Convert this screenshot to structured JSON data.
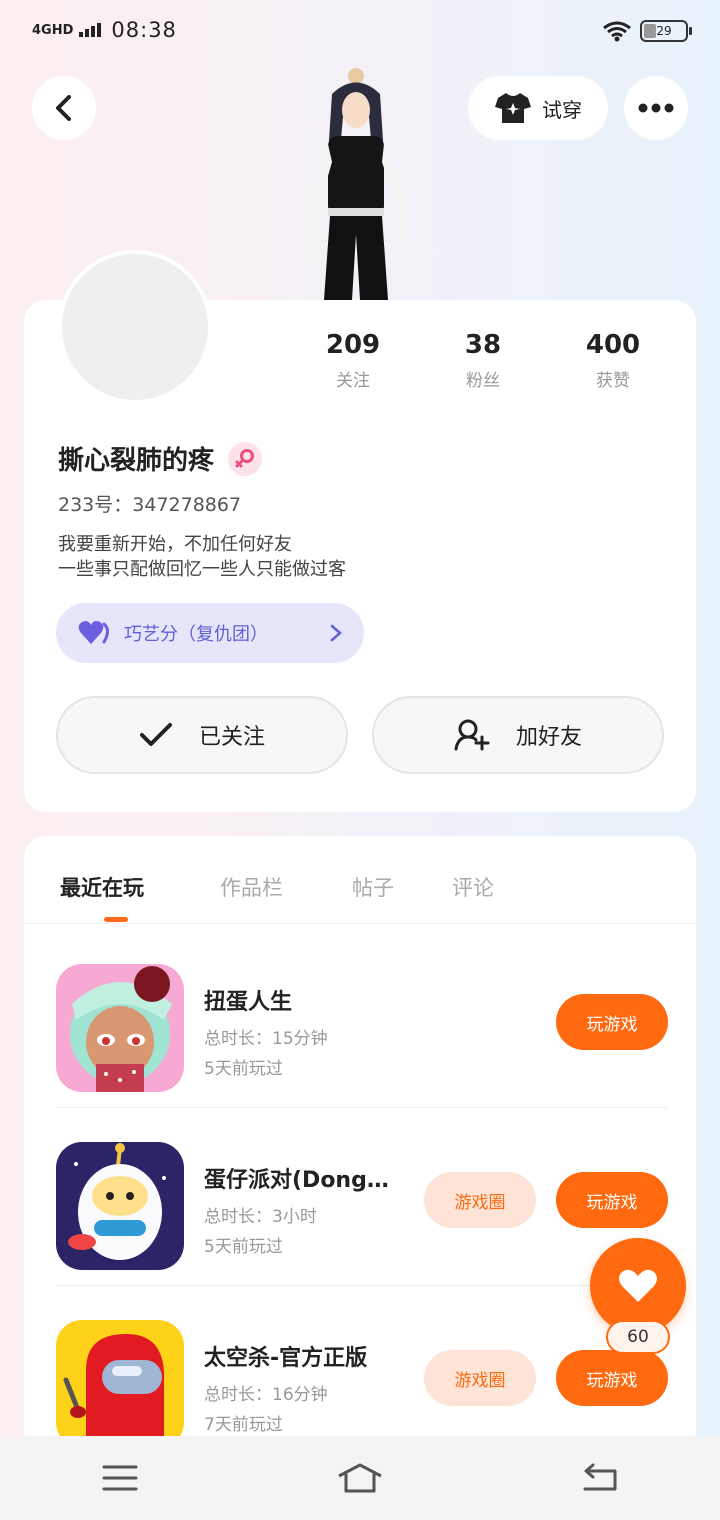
{
  "status_bar": {
    "network": "4GHD",
    "time": "08:38",
    "battery": "29"
  },
  "header": {
    "try_on_label": "试穿"
  },
  "profile": {
    "stats": [
      {
        "value": "209",
        "label": "关注"
      },
      {
        "value": "38",
        "label": "粉丝"
      },
      {
        "value": "400",
        "label": "获赞"
      }
    ],
    "username": "撕心裂肺的疼",
    "uid": "233号：347278867",
    "bio_lines": [
      "我要重新开始，不加任何好友",
      "一些事只配做回忆一些人只能做过客"
    ],
    "skill": "巧艺分（复仇团）",
    "followed_label": "已关注",
    "add_friend_label": "加好友"
  },
  "tabs": [
    "最近在玩",
    "作品栏",
    "帖子",
    "评论"
  ],
  "games": [
    {
      "name": "扭蛋人生",
      "duration": "总时长：15分钟",
      "last_played": "5天前玩过",
      "circle_label": null,
      "play_label": "玩游戏"
    },
    {
      "name": "蛋仔派对(Dong…",
      "duration": "总时长：3小时",
      "last_played": "5天前玩过",
      "circle_label": "游戏圈",
      "play_label": "玩游戏"
    },
    {
      "name": "太空杀-官方正版",
      "duration": "总时长：16分钟",
      "last_played": "7天前玩过",
      "circle_label": "游戏圈",
      "play_label": "玩游戏"
    }
  ],
  "like_count": "60",
  "colors": {
    "accent": "#ff6a10",
    "skill_bg": "#e6e6fb",
    "skill_text": "#6060d8"
  }
}
